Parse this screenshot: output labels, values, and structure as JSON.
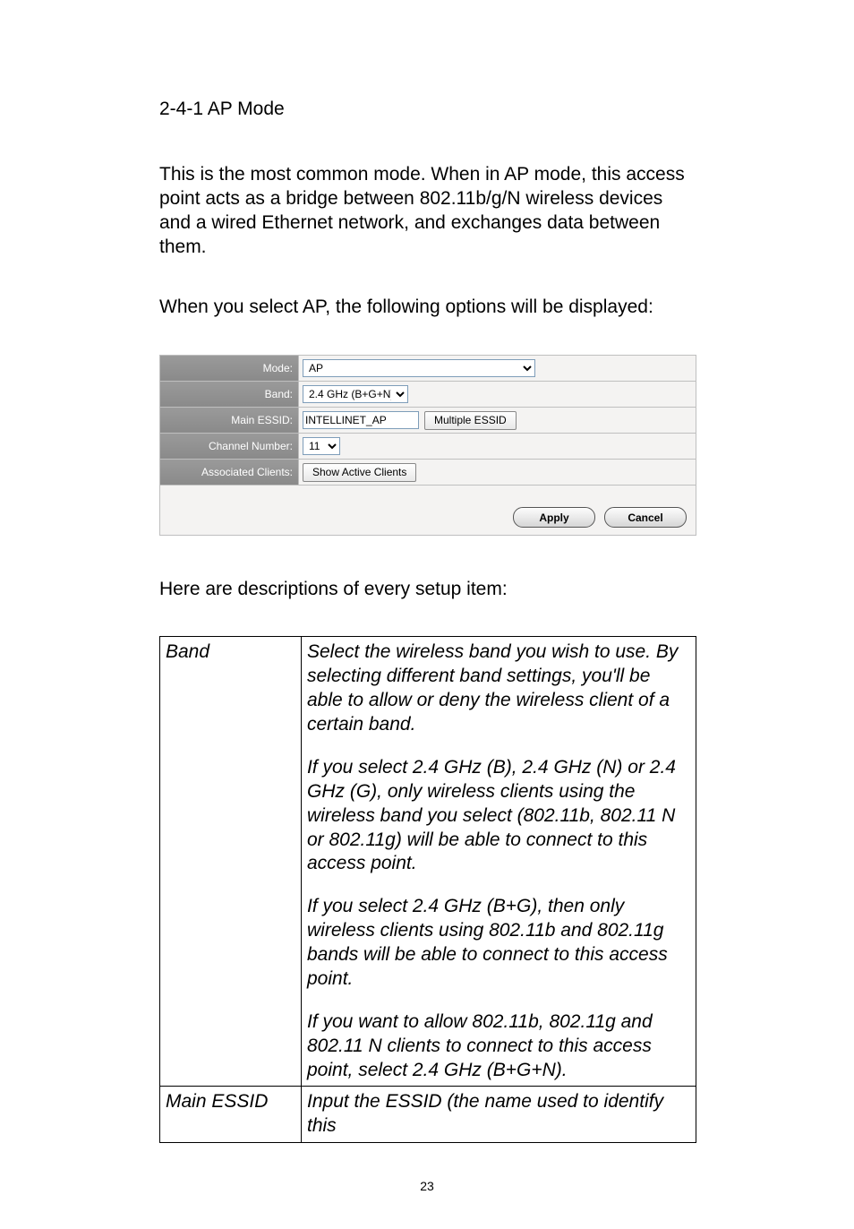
{
  "section_title": "2-4-1 AP Mode",
  "paragraph1": "This is the most common mode. When in AP mode, this access point acts as a bridge between 802.11b/g/N wireless devices and a wired Ethernet network, and exchanges data between them.",
  "paragraph2": "When you select AP, the following options will be displayed:",
  "config": {
    "rows": {
      "mode": {
        "label": "Mode:",
        "value": "AP"
      },
      "band": {
        "label": "Band:",
        "value": "2.4 GHz (B+G+N)"
      },
      "essid": {
        "label": "Main ESSID:",
        "value": "INTELLINET_AP",
        "button": "Multiple ESSID"
      },
      "chan": {
        "label": "Channel Number:",
        "value": "11"
      },
      "assoc": {
        "label": "Associated Clients:",
        "button": "Show Active Clients"
      }
    },
    "apply": "Apply",
    "cancel": "Cancel"
  },
  "desc_intro": "Here are descriptions of every setup item:",
  "table": {
    "band_key": "Band",
    "band_p1": "Select the wireless band you wish to use. By selecting different band settings, you'll be able to allow or deny the wireless client of a certain band.",
    "band_p2": "If you select 2.4 GHz (B), 2.4 GHz (N) or 2.4 GHz (G), only wireless clients using the wireless band you select (802.11b, 802.11 N or 802.11g) will be able to connect to this access point.",
    "band_p3": "If you select 2.4 GHz (B+G), then only wireless clients using 802.11b and 802.11g bands will be able to connect to this access point.",
    "band_p4": "If you want to allow 802.11b, 802.11g and 802.11 N clients to connect to this access point, select 2.4 GHz (B+G+N).",
    "essid_key": "Main ESSID",
    "essid_p1": "Input the ESSID (the name used to identify this"
  },
  "page_number": "23"
}
